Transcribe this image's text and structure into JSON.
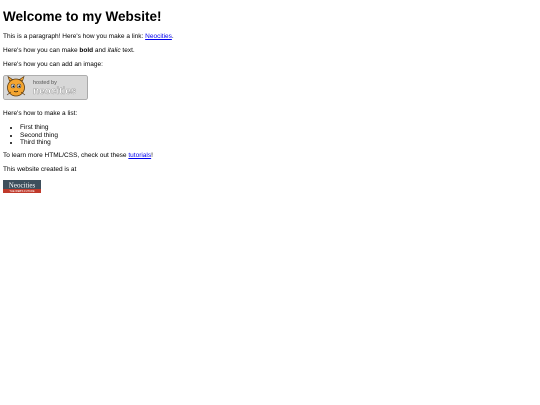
{
  "page": {
    "heading": "Welcome to my Website!",
    "paragraph_link": {
      "before": "This is a paragraph! Here's how you make a link: ",
      "link_text": "Neocities",
      "after": "."
    },
    "bold_italic": {
      "before": "Here's how you can make ",
      "bold": "bold",
      "middle": " and ",
      "italic": "italic",
      "after": " text."
    },
    "image_intro": "Here's how you can add an image:",
    "hosted_badge": {
      "line1": "hosted by",
      "line2": "neocities"
    },
    "list_intro": "Here's how to make a list:",
    "list_items": [
      "First thing",
      "Second thing",
      "Third thing"
    ],
    "learn_more": {
      "before": "To learn more HTML/CSS, check out these ",
      "link_text": "tutorials",
      "after": "!"
    },
    "created_at": "This website created is at",
    "small_badge": {
      "line1": "Neocities",
      "line2": "THE WEB'S FUTURE"
    }
  },
  "colors": {
    "link": "#0000ee",
    "badge_bg": "#d8d8d8",
    "small_badge_bg": "#3d4f5c",
    "small_badge_stripe": "#c0392b"
  }
}
